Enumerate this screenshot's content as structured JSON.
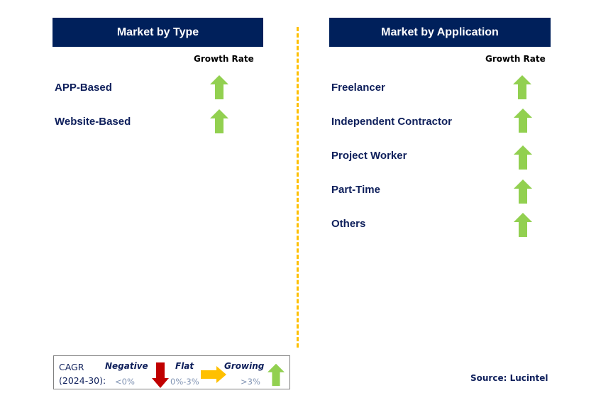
{
  "left_panel": {
    "title": "Market by Type",
    "growth_rate_label": "Growth Rate",
    "items": [
      {
        "label": "APP-Based",
        "trend": "growing"
      },
      {
        "label": "Website-Based",
        "trend": "growing"
      }
    ]
  },
  "right_panel": {
    "title": "Market by Application",
    "growth_rate_label": "Growth Rate",
    "items": [
      {
        "label": "Freelancer",
        "trend": "growing"
      },
      {
        "label": "Independent Contractor",
        "trend": "growing"
      },
      {
        "label": "Project Worker",
        "trend": "growing"
      },
      {
        "label": "Part-Time",
        "trend": "growing"
      },
      {
        "label": "Others",
        "trend": "growing"
      }
    ]
  },
  "legend": {
    "cagr_line1": "CAGR",
    "cagr_line2": "(2024-30):",
    "negative": {
      "label": "Negative",
      "range": "<0%",
      "icon": "arrow-down-icon",
      "color": "#c00000"
    },
    "flat": {
      "label": "Flat",
      "range": "0%-3%",
      "icon": "arrow-right-icon",
      "color": "#ffc000"
    },
    "growing": {
      "label": "Growing",
      "range": ">3%",
      "icon": "arrow-up-icon",
      "color": "#92d050"
    }
  },
  "source": "Source: Lucintel",
  "colors": {
    "header_bg": "#00205b",
    "divider": "#ffc000",
    "growing": "#92d050"
  }
}
